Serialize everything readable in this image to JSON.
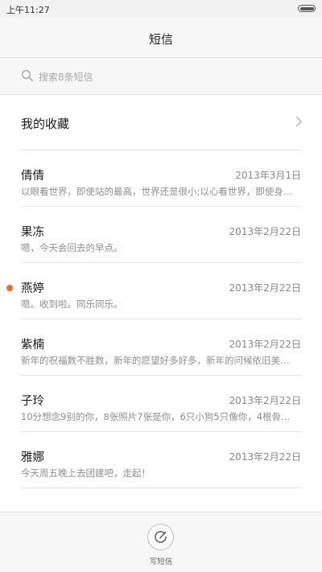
{
  "status_bar": {
    "time": "上午11:27"
  },
  "header": {
    "title": "短信"
  },
  "search": {
    "placeholder": "搜索8条短信"
  },
  "favorites": {
    "label": "我的收藏"
  },
  "conversations": [
    {
      "name": "倩倩",
      "date": "2013年3月1日",
      "preview": "以眼看世界，即使站的最高，世界还是很小;以心看世界，即使身…",
      "unread": false
    },
    {
      "name": "果冻",
      "date": "2013年2月22日",
      "preview": "嗯，今天会回去的早点。",
      "unread": false
    },
    {
      "name": "燕婷",
      "date": "2013年2月22日",
      "preview": "嗯。收到啦。同乐同乐。",
      "unread": true
    },
    {
      "name": "紫楠",
      "date": "2013年2月22日",
      "preview": "新年的祝福数不胜数，新年的愿望好多好多，新年的问候依旧美…",
      "unread": false
    },
    {
      "name": "子玲",
      "date": "2013年2月22日",
      "preview": "10分想念9别的你，8张照片7张是你，6只小狗5只像你，4根骨…",
      "unread": false
    },
    {
      "name": "雅娜",
      "date": "2013年2月22日",
      "preview": "今天周五晚上去团建吧，走起！",
      "unread": false
    }
  ],
  "compose": {
    "label": "写短信"
  },
  "colors": {
    "unread_dot": "#f06b25",
    "divider": "#e6e6e6",
    "secondary_text": "#8a8a8a"
  }
}
